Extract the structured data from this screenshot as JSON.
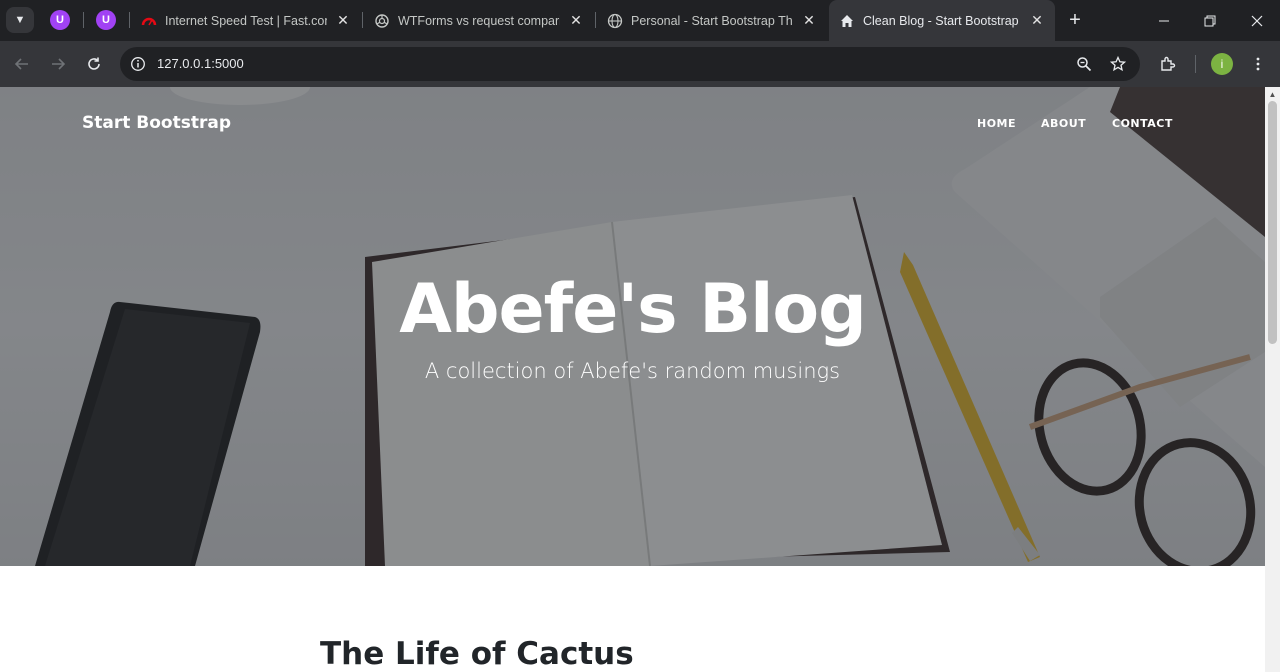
{
  "browser": {
    "tabs": [
      {
        "title": "Internet Speed Test | Fast.com",
        "favicon": "speedometer-icon"
      },
      {
        "title": "WTForms vs request comparison",
        "favicon": "openai-icon"
      },
      {
        "title": "Personal - Start Bootstrap Theme",
        "favicon": "globe-icon"
      },
      {
        "title": "Clean Blog - Start Bootstrap Theme",
        "favicon": "home-icon",
        "active": true
      }
    ],
    "pinned_tabs": [
      "U",
      "U"
    ],
    "url": "127.0.0.1:5000",
    "profile_initial": "i"
  },
  "site": {
    "brand": "Start Bootstrap",
    "nav": [
      "HOME",
      "ABOUT",
      "CONTACT"
    ],
    "hero_title": "Abefe's Blog",
    "hero_subtitle": "A collection of Abefe's random musings",
    "first_post_title": "The Life of Cactus"
  },
  "colors": {
    "chrome_dark": "#202124",
    "chrome_toolbar": "#35363a",
    "accent_purple": "#a142f4",
    "profile_green": "#7cb342",
    "heading_text": "#212529"
  }
}
